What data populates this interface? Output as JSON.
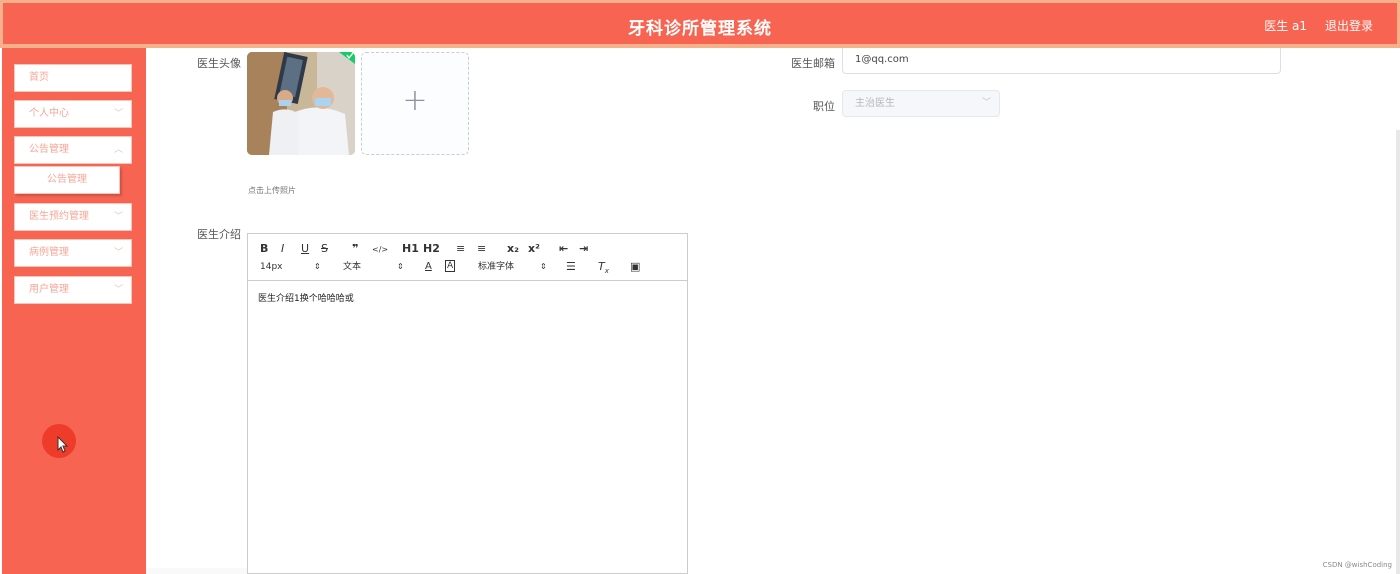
{
  "header": {
    "title": "牙科诊所管理系统",
    "user": "医生 a1",
    "logout": "退出登录"
  },
  "sidebar": {
    "items": [
      {
        "label": "首页",
        "has_chevron": false
      },
      {
        "label": "个人中心",
        "has_chevron": true
      },
      {
        "label": "公告管理",
        "has_chevron": true
      },
      {
        "label": "医生预约管理",
        "has_chevron": true
      },
      {
        "label": "病例管理",
        "has_chevron": true
      },
      {
        "label": "用户管理",
        "has_chevron": true
      }
    ],
    "submenu": {
      "label": "公告管理"
    }
  },
  "form": {
    "avatar_label": "医生头像",
    "upload_hint": "点击上传照片",
    "intro_label": "医生介绍",
    "email_label": "医生邮箱",
    "email_value": "1@qq.com",
    "position_label": "职位",
    "position_value": "主治医生"
  },
  "editor": {
    "toolbar_row1": [
      "B",
      "I",
      "U",
      "S",
      "❞",
      "</>",
      "H1",
      "H2",
      "≡",
      "≡",
      "x₂",
      "x²",
      "⇤",
      "⇥"
    ],
    "font_size": "14px",
    "text_type": "文本",
    "font_family": "标准字体",
    "content": "医生介绍1换个哈哈哈或"
  },
  "watermark": "CSDN @wishCoding",
  "colors": {
    "brand": "#f86452",
    "header_border": "#f6b08a",
    "menu_text": "#f8a696",
    "cursor_dot": "#ee3b2a"
  }
}
